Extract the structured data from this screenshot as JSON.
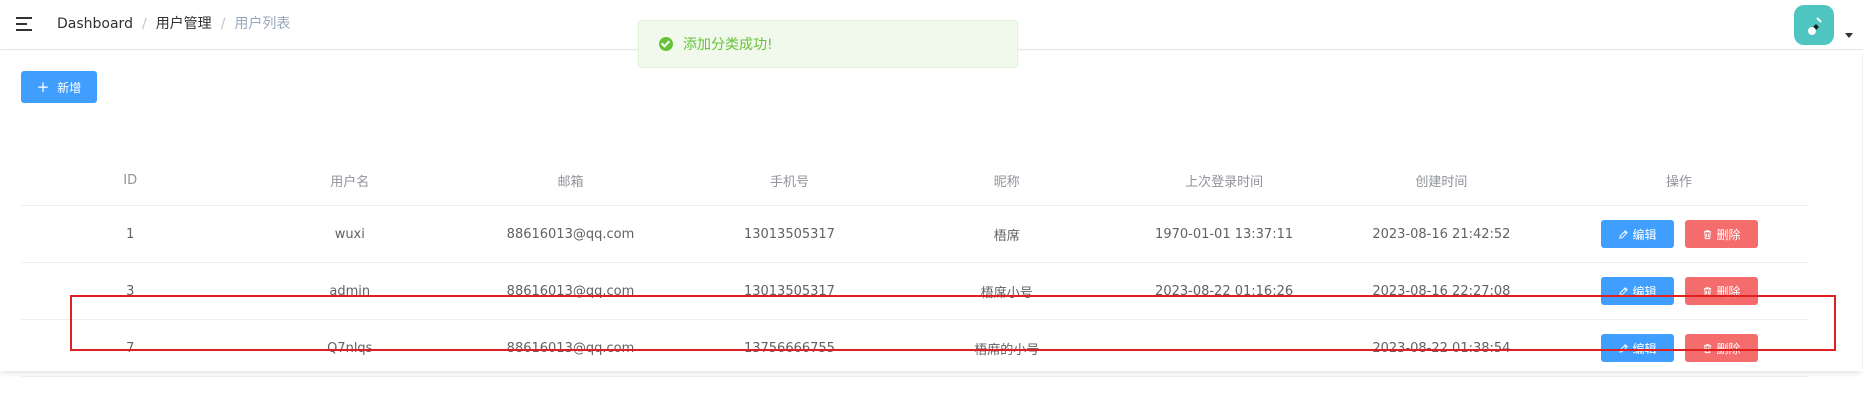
{
  "breadcrumb": [
    "Dashboard",
    "用户管理",
    "用户列表"
  ],
  "toast": {
    "message": "添加分类成功!"
  },
  "toolbar": {
    "add_label": "新增"
  },
  "table": {
    "columns": [
      "ID",
      "用户名",
      "邮箱",
      "手机号",
      "昵称",
      "上次登录时间",
      "创建时间",
      "操作"
    ],
    "rows": [
      {
        "id": "1",
        "username": "wuxi",
        "email": "88616013@qq.com",
        "phone": "13013505317",
        "nickname": "梧席",
        "last_login": "1970-01-01 13:37:11",
        "created": "2023-08-16 21:42:52"
      },
      {
        "id": "3",
        "username": "admin",
        "email": "88616013@qq.com",
        "phone": "13013505317",
        "nickname": "梧席小号",
        "last_login": "2023-08-22 01:16:26",
        "created": "2023-08-16 22:27:08"
      },
      {
        "id": "7",
        "username": "Q7nlqs",
        "email": "88616013@qq.com",
        "phone": "13756666755",
        "nickname": "梧席的小号",
        "last_login": "",
        "created": "2023-08-22 01:38:54"
      }
    ],
    "edit_label": "编辑",
    "delete_label": "删除"
  },
  "colors": {
    "primary": "#409eff",
    "danger": "#f56c6c",
    "success": "#67c23a",
    "avatar_bg": "#4ec5c1",
    "highlight": "#e02020"
  }
}
